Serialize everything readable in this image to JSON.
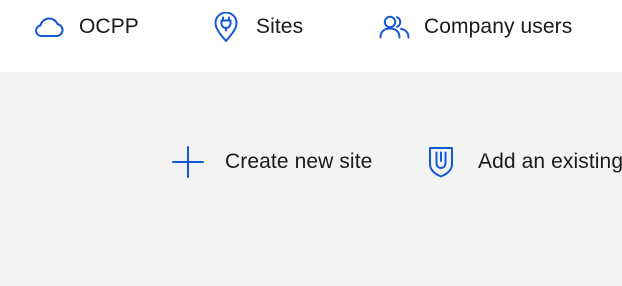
{
  "nav": {
    "items": [
      {
        "label": "OCPP",
        "icon": "cloud-icon"
      },
      {
        "label": "Sites",
        "icon": "location-pin-plug-icon"
      },
      {
        "label": "Company users",
        "icon": "users-icon"
      }
    ]
  },
  "actions": {
    "create_site": {
      "label": "Create new site",
      "icon": "plus-icon"
    },
    "add_existing": {
      "label": "Add an existing",
      "icon": "shield-link-icon"
    }
  },
  "colors": {
    "accent": "#1358d6",
    "header_bg": "#ffffff",
    "page_bg": "#f3f3f3",
    "text": "#1a1a1a"
  }
}
